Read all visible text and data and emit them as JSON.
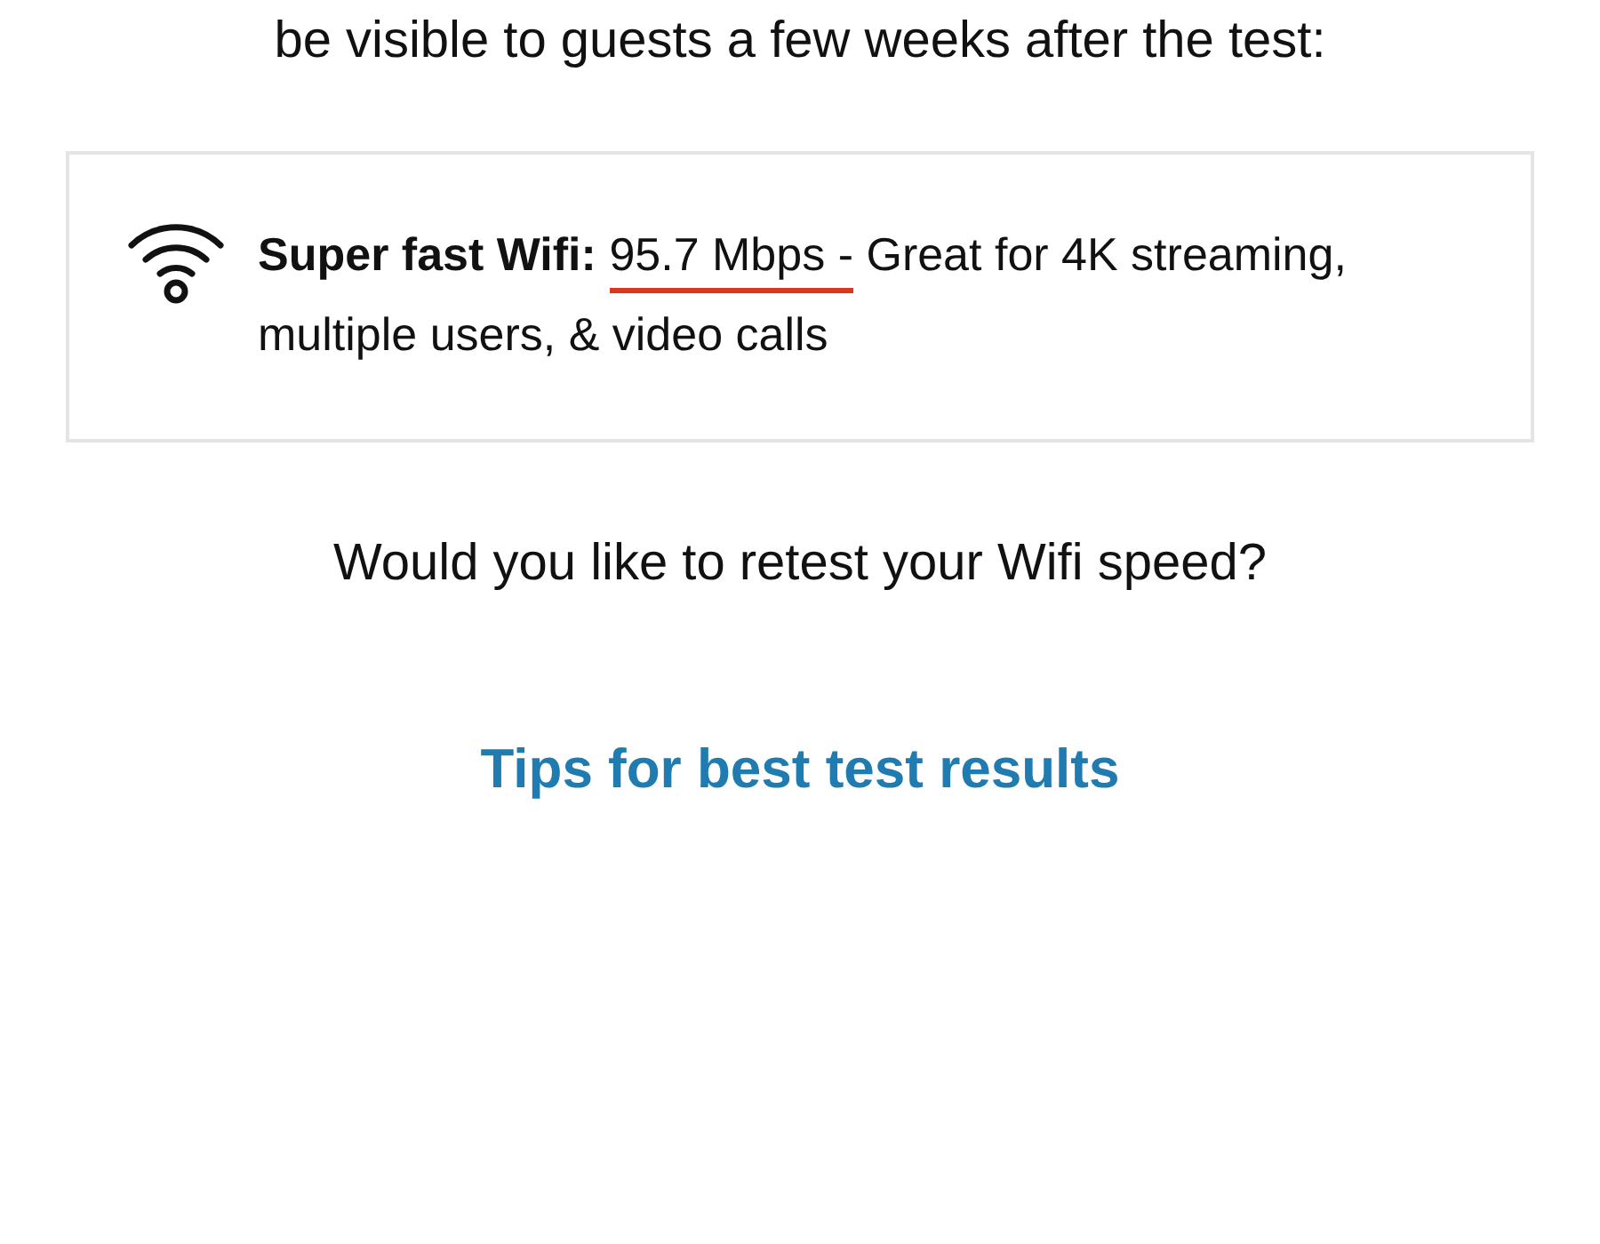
{
  "intro": "be visible to guests a few weeks after the test:",
  "result": {
    "label": "Super fast Wifi:",
    "highlight": {
      "text": "95.7 Mbps -",
      "underlined": true
    },
    "rest": "Great for 4K streaming, multiple users, & video calls"
  },
  "question": "Would you like to retest your Wifi speed?",
  "tips_link": "Tips for best test results"
}
